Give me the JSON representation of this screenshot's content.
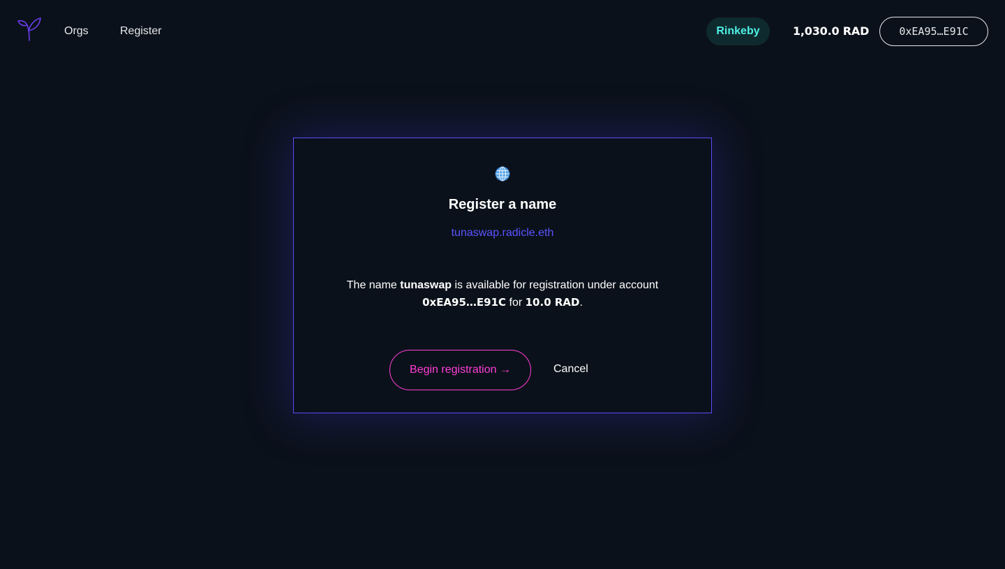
{
  "header": {
    "logo_icon": "radicle-sprout-icon",
    "nav": [
      {
        "label": "Orgs"
      },
      {
        "label": "Register"
      }
    ],
    "network": "Rinkeby",
    "balance": "1,030.0 RAD",
    "account": "0xEA95…E91C"
  },
  "modal": {
    "icon": "globe-icon",
    "title": "Register a name",
    "domain": "tunaswap.radicle.eth",
    "message": {
      "part1": "The name ",
      "name": "tunaswap",
      "part2": " is available for registration under account ",
      "account": "0xEA95…E91C",
      "part3": " for ",
      "fee": "10.0 RAD",
      "part4": "."
    },
    "begin_button": "Begin registration →",
    "cancel_button": "Cancel"
  },
  "colors": {
    "background": "#0b111a",
    "accent_purple": "#5a4dfa",
    "link_blue": "#5a53ff",
    "button_pink": "#ff3fd8",
    "network_cyan": "#4ff0e6"
  }
}
